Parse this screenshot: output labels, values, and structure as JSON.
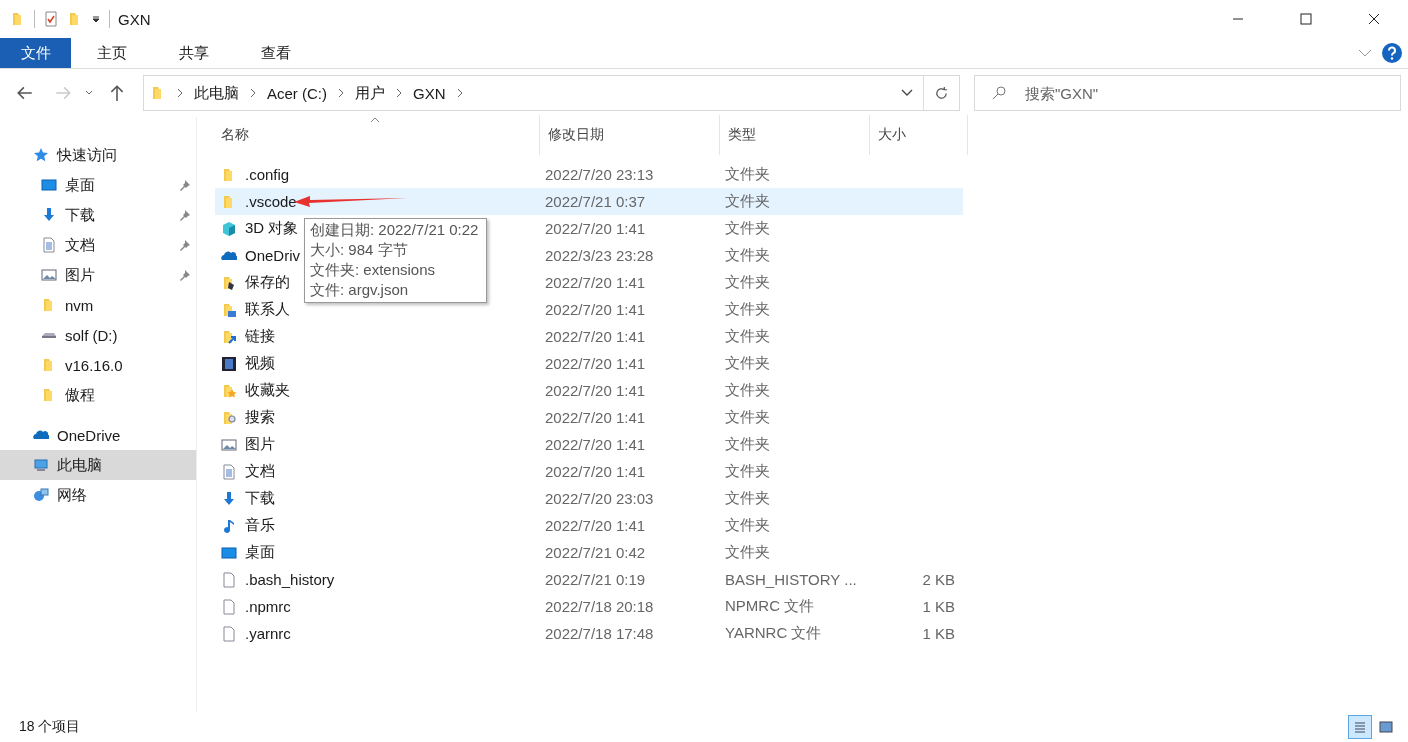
{
  "window": {
    "title": "GXN"
  },
  "ribbon_tabs": [
    {
      "label": "文件",
      "kind": "file_menu"
    },
    {
      "label": "主页",
      "kind": "tab"
    },
    {
      "label": "共享",
      "kind": "tab"
    },
    {
      "label": "查看",
      "kind": "tab"
    }
  ],
  "address_bar": {
    "breadcrumbs": [
      "此电脑",
      "Acer (C:)",
      "用户",
      "GXN"
    ]
  },
  "search": {
    "placeholder": "搜索\"GXN\""
  },
  "sidebar": {
    "items": [
      {
        "label": "快速访问",
        "kind": "star",
        "selected": false,
        "children": [
          {
            "label": "桌面",
            "kind": "desktop",
            "pinned": true,
            "selected": false
          },
          {
            "label": "下载",
            "kind": "downloads",
            "pinned": true,
            "selected": false
          },
          {
            "label": "文档",
            "kind": "documents",
            "pinned": true,
            "selected": false
          },
          {
            "label": "图片",
            "kind": "pictures",
            "pinned": true,
            "selected": false
          },
          {
            "label": "nvm",
            "kind": "folder",
            "pinned": false,
            "selected": false
          },
          {
            "label": "solf (D:)",
            "kind": "drive",
            "pinned": false,
            "selected": false
          },
          {
            "label": "v16.16.0",
            "kind": "folder",
            "pinned": false,
            "selected": false
          },
          {
            "label": "傲程",
            "kind": "folder",
            "pinned": false,
            "selected": false
          }
        ]
      },
      {
        "label": "OneDrive",
        "kind": "cloud",
        "selected": false
      },
      {
        "label": "此电脑",
        "kind": "pc",
        "selected": true
      },
      {
        "label": "网络",
        "kind": "network",
        "selected": false
      }
    ]
  },
  "table": {
    "columns": [
      {
        "label": "名称",
        "sorted": true
      },
      {
        "label": "修改日期",
        "sorted": false
      },
      {
        "label": "类型",
        "sorted": false
      },
      {
        "label": "大小",
        "sorted": false
      }
    ],
    "rows": [
      {
        "name": ".config",
        "date": "2022/7/20 23:13",
        "type": "文件夹",
        "kind": "folder",
        "selected": false
      },
      {
        "name": ".vscode",
        "date": "2022/7/21 0:37",
        "type": "文件夹",
        "kind": "folder",
        "selected": true
      },
      {
        "name": "3D 对象",
        "date": "2022/7/20 1:41",
        "type": "文件夹",
        "kind": "cube",
        "selected": false
      },
      {
        "name": "OneDriv",
        "date": "2022/3/23 23:28",
        "type": "文件夹",
        "kind": "cloud",
        "selected": false
      },
      {
        "name": "保存的",
        "date": "2022/7/20 1:41",
        "type": "文件夹",
        "kind": "games",
        "selected": false
      },
      {
        "name": "联系人",
        "date": "2022/7/20 1:41",
        "type": "文件夹",
        "kind": "contacts",
        "selected": false
      },
      {
        "name": "链接",
        "date": "2022/7/20 1:41",
        "type": "文件夹",
        "kind": "links",
        "selected": false
      },
      {
        "name": "视频",
        "date": "2022/7/20 1:41",
        "type": "文件夹",
        "kind": "video",
        "selected": false
      },
      {
        "name": "收藏夹",
        "date": "2022/7/20 1:41",
        "type": "文件夹",
        "kind": "favorites",
        "selected": false
      },
      {
        "name": "搜索",
        "date": "2022/7/20 1:41",
        "type": "文件夹",
        "kind": "search",
        "selected": false
      },
      {
        "name": "图片",
        "date": "2022/7/20 1:41",
        "type": "文件夹",
        "kind": "pictures",
        "selected": false
      },
      {
        "name": "文档",
        "date": "2022/7/20 1:41",
        "type": "文件夹",
        "kind": "documents",
        "selected": false
      },
      {
        "name": "下载",
        "date": "2022/7/20 23:03",
        "type": "文件夹",
        "kind": "downloads",
        "selected": false
      },
      {
        "name": "音乐",
        "date": "2022/7/20 1:41",
        "type": "文件夹",
        "kind": "music",
        "selected": false
      },
      {
        "name": "桌面",
        "date": "2022/7/21 0:42",
        "type": "文件夹",
        "kind": "desktop",
        "selected": false
      },
      {
        "name": ".bash_history",
        "date": "2022/7/21 0:19",
        "type": "BASH_HISTORY ...",
        "size": "2 KB",
        "kind": "file",
        "selected": false
      },
      {
        "name": ".npmrc",
        "date": "2022/7/18 20:18",
        "type": "NPMRC 文件",
        "size": "1 KB",
        "kind": "file",
        "selected": false
      },
      {
        "name": ".yarnrc",
        "date": "2022/7/18 17:48",
        "type": "YARNRC 文件",
        "size": "1 KB",
        "kind": "file",
        "selected": false
      }
    ]
  },
  "tooltip": {
    "lines": [
      "创建日期: 2022/7/21 0:22",
      "大小: 984 字节",
      "文件夹: extensions",
      "文件: argv.json"
    ]
  },
  "status_bar": {
    "item_count": "18 个项目",
    "views": [
      {
        "kind": "details",
        "selected": true
      },
      {
        "kind": "large_icons",
        "selected": false
      }
    ]
  }
}
